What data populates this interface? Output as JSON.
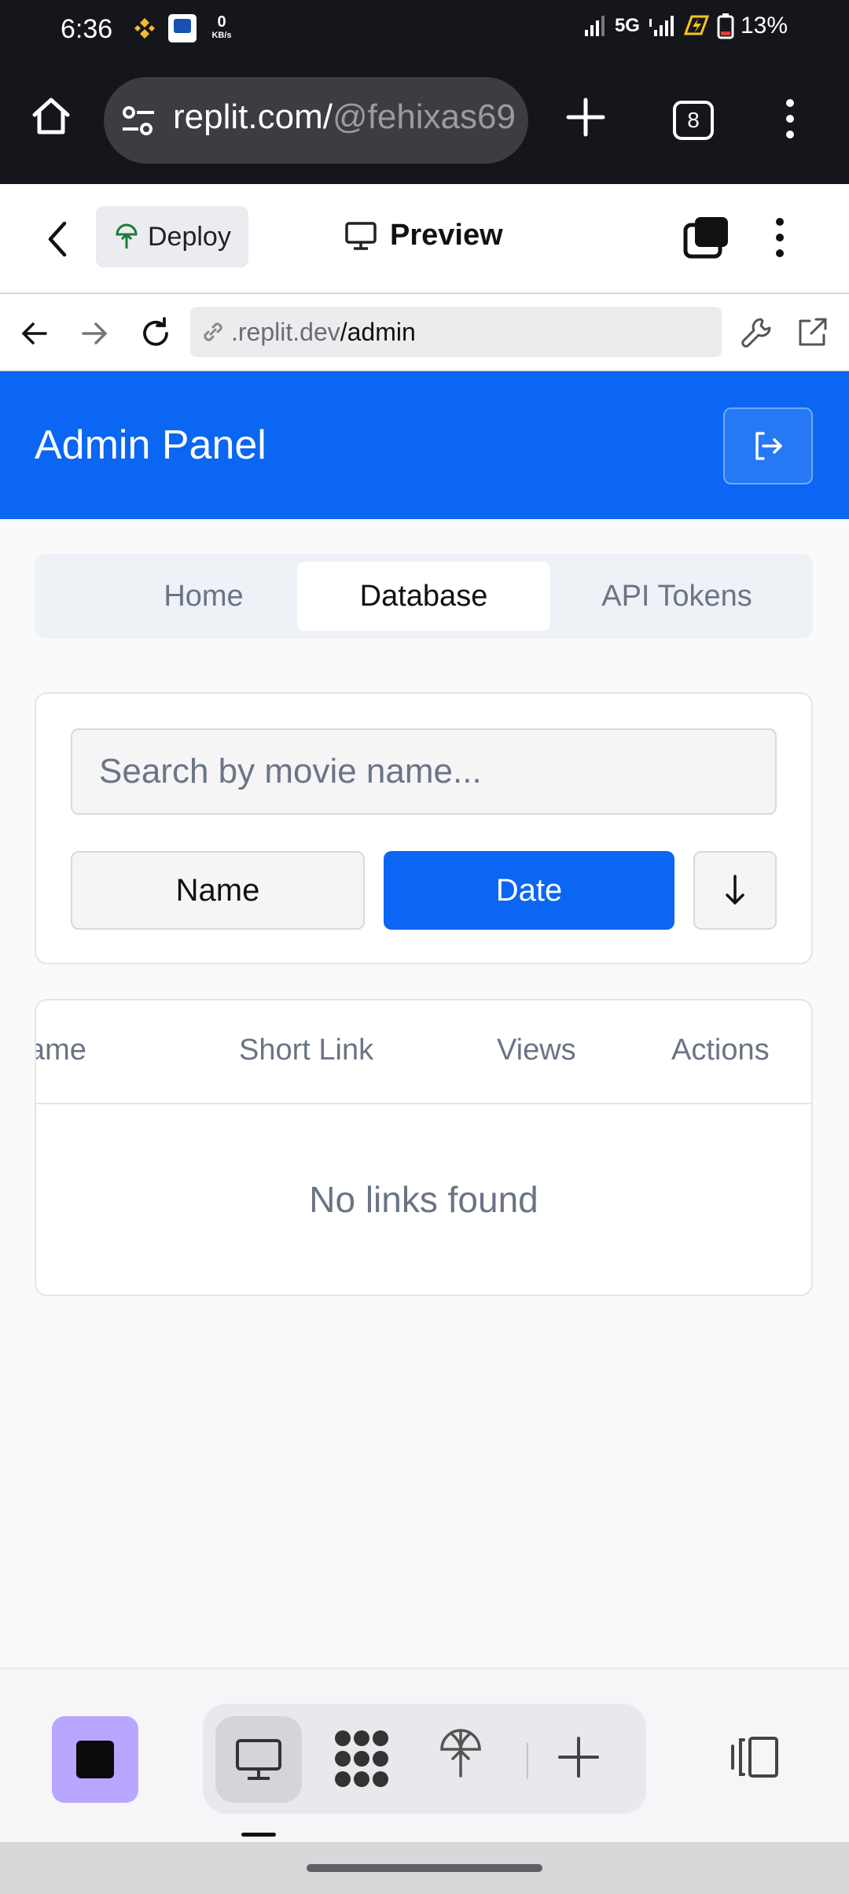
{
  "status_bar": {
    "time": "6:36",
    "network_speed": "0",
    "network_unit": "KB/s",
    "network_type": "5G",
    "battery": "13%"
  },
  "browser": {
    "url_host": "replit.com/",
    "url_path": "@fehixas69",
    "tab_count": "8"
  },
  "replit": {
    "deploy_label": "Deploy",
    "preview_label": "Preview"
  },
  "inner_browser": {
    "url_domain": ".replit.dev",
    "url_path": "/admin"
  },
  "admin": {
    "title": "Admin Panel",
    "tabs": [
      {
        "label": "Home",
        "active": false
      },
      {
        "label": "Database",
        "active": true
      },
      {
        "label": "API Tokens",
        "active": false
      }
    ],
    "search": {
      "placeholder": "Search by movie name...",
      "value": ""
    },
    "sort": {
      "options": [
        {
          "label": "Name",
          "active": false
        },
        {
          "label": "Date",
          "active": true
        }
      ],
      "direction_label": "↓"
    },
    "table": {
      "columns": [
        "ame",
        "Short Link",
        "Views",
        "Actions"
      ],
      "rows": [],
      "empty_message": "No links found"
    }
  },
  "colors": {
    "primary": "#0a66f3",
    "muted_text": "#6b7485",
    "dark_chrome": "#15161b",
    "stop_button": "#b9a6ff"
  },
  "icons": [
    "home-icon",
    "tune-icon",
    "plus-icon",
    "more-vert-icon",
    "chevron-left-icon",
    "deploy-icon",
    "monitor-icon",
    "layers-icon",
    "arrow-left-icon",
    "arrow-right-icon",
    "refresh-icon",
    "link-icon",
    "wrench-icon",
    "external-link-icon",
    "logout-icon",
    "arrow-down-icon",
    "stop-icon",
    "apps-icon",
    "panel-icon"
  ]
}
